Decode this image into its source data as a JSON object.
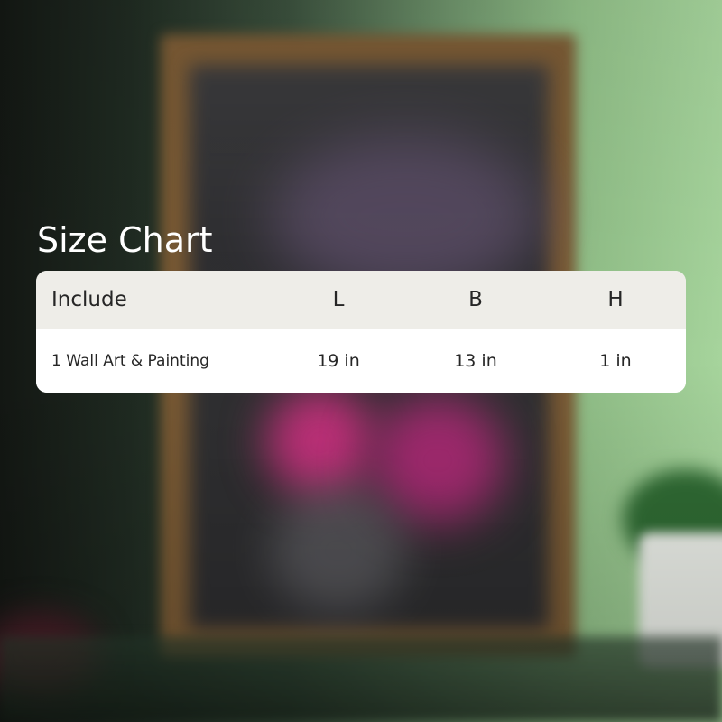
{
  "title": "Size Chart",
  "table": {
    "headers": [
      "Include",
      "L",
      "B",
      "H"
    ],
    "rows": [
      [
        "1 Wall Art & Painting",
        "19 in",
        "13 in",
        "1 in"
      ]
    ]
  },
  "colors": {
    "header_bg": "#eeede8",
    "row_bg": "#ffffff",
    "text": "#262626",
    "title": "#ffffff"
  }
}
